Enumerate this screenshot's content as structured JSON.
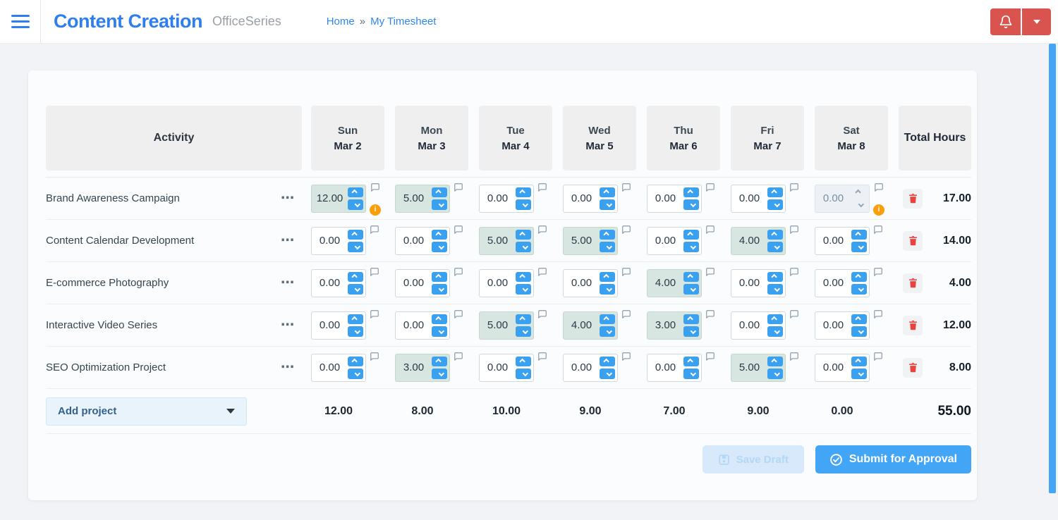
{
  "colors": {
    "accent_blue": "#2e7ef0",
    "spinner_blue": "#3aa0f0",
    "submit_blue": "#42a5f5",
    "danger_red": "#d9534f",
    "trash_red": "#e8433f",
    "warning_orange": "#fb9e0c",
    "filled_cell_green": "#d8e6e1",
    "scrollbar_blue": "#42a5f5"
  },
  "header": {
    "menu_icon": "hamburger-icon",
    "app_title": "Content Creation",
    "suite_name": "OfficeSeries",
    "breadcrumb": {
      "home": "Home",
      "separator": "»",
      "current": "My Timesheet"
    },
    "notification_icon": "bell-icon",
    "account_icon": "caret-down-icon"
  },
  "timesheet": {
    "activity_header": "Activity",
    "days": [
      {
        "name": "Sun",
        "date": "Mar 2"
      },
      {
        "name": "Mon",
        "date": "Mar 3"
      },
      {
        "name": "Tue",
        "date": "Mar 4"
      },
      {
        "name": "Wed",
        "date": "Mar 5"
      },
      {
        "name": "Thu",
        "date": "Mar 6"
      },
      {
        "name": "Fri",
        "date": "Mar 7"
      },
      {
        "name": "Sat",
        "date": "Mar 8"
      }
    ],
    "total_header": "Total Hours",
    "rows": [
      {
        "activity": "Brand Awareness Campaign",
        "cells": [
          {
            "value": "12.00",
            "filled": true,
            "warning": true
          },
          {
            "value": "5.00",
            "filled": true
          },
          {
            "value": "0.00"
          },
          {
            "value": "0.00"
          },
          {
            "value": "0.00"
          },
          {
            "value": "0.00"
          },
          {
            "value": "0.00",
            "disabled": true,
            "warning": true
          }
        ],
        "total": "17.00"
      },
      {
        "activity": "Content Calendar Development",
        "cells": [
          {
            "value": "0.00"
          },
          {
            "value": "0.00"
          },
          {
            "value": "5.00",
            "filled": true
          },
          {
            "value": "5.00",
            "filled": true
          },
          {
            "value": "0.00"
          },
          {
            "value": "4.00",
            "filled": true
          },
          {
            "value": "0.00"
          }
        ],
        "total": "14.00"
      },
      {
        "activity": "E-commerce Photography",
        "cells": [
          {
            "value": "0.00"
          },
          {
            "value": "0.00"
          },
          {
            "value": "0.00"
          },
          {
            "value": "0.00"
          },
          {
            "value": "4.00",
            "filled": true
          },
          {
            "value": "0.00"
          },
          {
            "value": "0.00"
          }
        ],
        "total": "4.00"
      },
      {
        "activity": "Interactive Video Series",
        "cells": [
          {
            "value": "0.00"
          },
          {
            "value": "0.00"
          },
          {
            "value": "5.00",
            "filled": true
          },
          {
            "value": "4.00",
            "filled": true
          },
          {
            "value": "3.00",
            "filled": true
          },
          {
            "value": "0.00"
          },
          {
            "value": "0.00"
          }
        ],
        "total": "12.00"
      },
      {
        "activity": "SEO Optimization Project",
        "cells": [
          {
            "value": "0.00"
          },
          {
            "value": "3.00",
            "filled": true
          },
          {
            "value": "0.00"
          },
          {
            "value": "0.00"
          },
          {
            "value": "0.00"
          },
          {
            "value": "5.00",
            "filled": true
          },
          {
            "value": "0.00"
          }
        ],
        "total": "8.00"
      }
    ],
    "footer": {
      "add_project_label": "Add project",
      "daily_totals": [
        "12.00",
        "8.00",
        "10.00",
        "9.00",
        "7.00",
        "9.00",
        "0.00"
      ],
      "grand_total": "55.00"
    },
    "actions": {
      "save_draft_label": "Save Draft",
      "submit_label": "Submit for Approval"
    }
  }
}
